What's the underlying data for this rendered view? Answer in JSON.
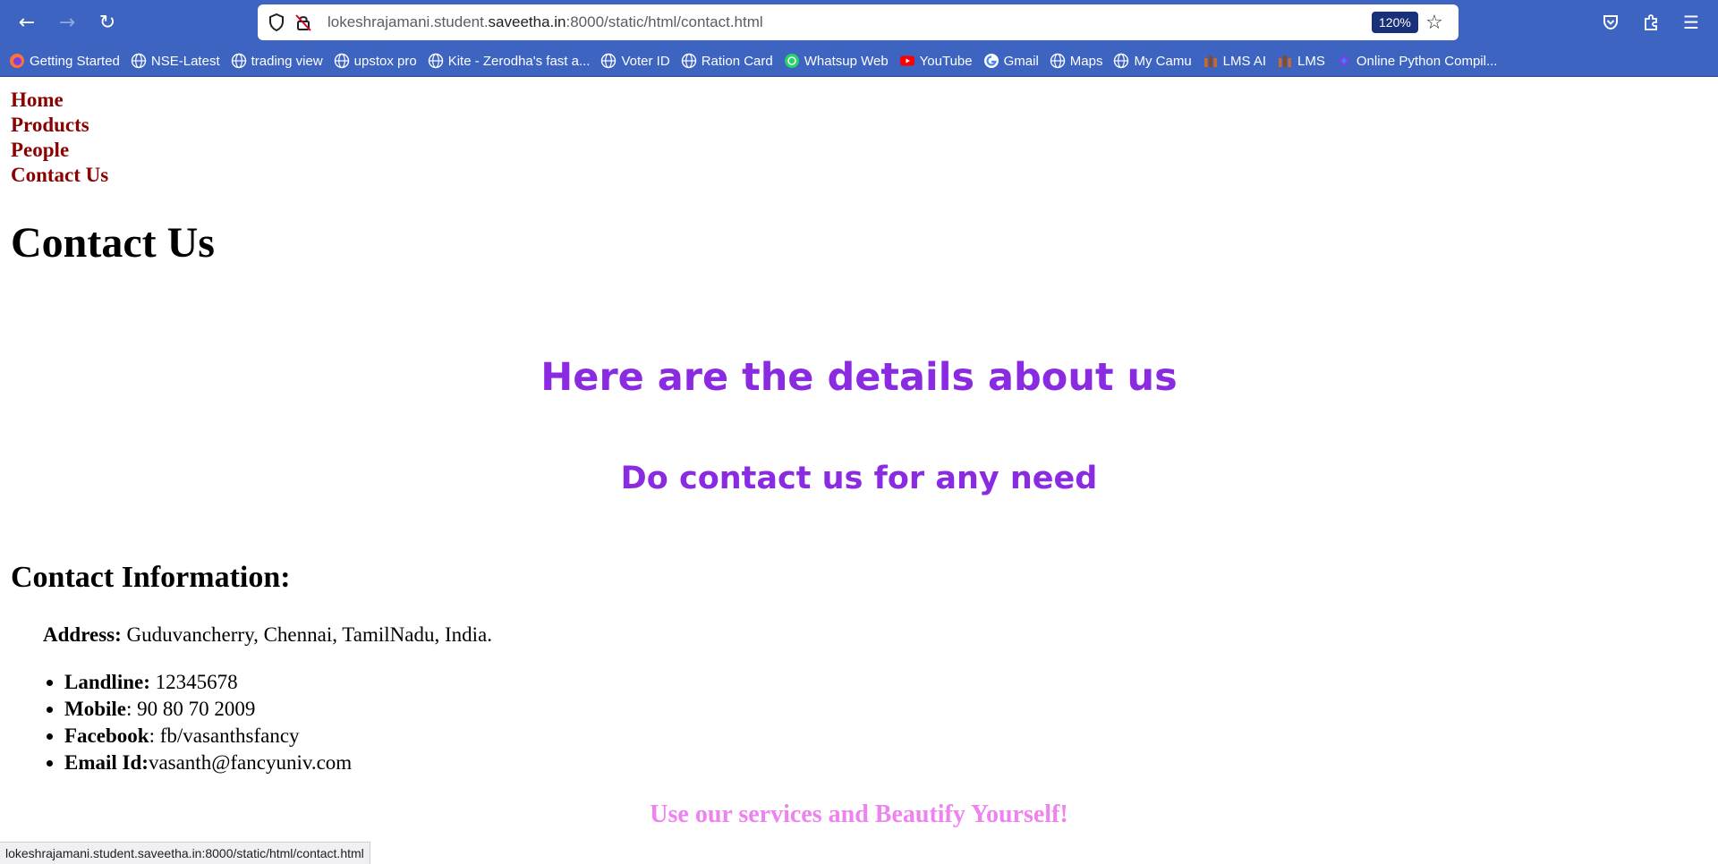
{
  "browser": {
    "url": {
      "prefix": "lokeshrajamani.student.",
      "domain": "saveetha.in",
      "suffix": ":8000/static/html/contact.html"
    },
    "zoom": "120%",
    "icons": {
      "back": "back-arrow-icon",
      "forward": "forward-arrow-icon",
      "reload": "reload-icon",
      "shield": "shield-icon",
      "insecure": "insecure-lock-icon",
      "star": "bookmark-star-icon",
      "pocket": "pocket-icon",
      "extensions": "extensions-puzzle-icon",
      "menu": "hamburger-menu-icon"
    },
    "bookmarks": [
      {
        "label": "Getting Started",
        "icon": "firefox-icon"
      },
      {
        "label": "NSE-Latest",
        "icon": "globe-icon"
      },
      {
        "label": "trading view",
        "icon": "globe-icon"
      },
      {
        "label": "upstox pro",
        "icon": "globe-icon"
      },
      {
        "label": "Kite - Zerodha's fast a...",
        "icon": "globe-icon"
      },
      {
        "label": "Voter ID",
        "icon": "globe-icon"
      },
      {
        "label": "Ration Card",
        "icon": "globe-icon"
      },
      {
        "label": "Whatsup Web",
        "icon": "whatsapp-icon"
      },
      {
        "label": "YouTube",
        "icon": "youtube-icon"
      },
      {
        "label": "Gmail",
        "icon": "google-icon"
      },
      {
        "label": "Maps",
        "icon": "globe-icon"
      },
      {
        "label": "My Camu",
        "icon": "globe-icon"
      },
      {
        "label": "LMS AI",
        "icon": "lms-icon"
      },
      {
        "label": "LMS",
        "icon": "lms-icon"
      },
      {
        "label": "Online Python Compil...",
        "icon": "python-compiler-icon"
      }
    ],
    "status_url": "lokeshrajamani.student.saveetha.in:8000/static/html/contact.html"
  },
  "site": {
    "nav": [
      "Home",
      "Products",
      "People",
      "Contact Us"
    ],
    "title": "Contact Us",
    "hero_heading": "Here are the details about us",
    "hero_sub": "Do contact us for any need",
    "info_heading": "Contact Information:",
    "address": {
      "label": "Address:",
      "value": " Guduvancherry, Chennai, TamilNadu, India."
    },
    "contacts": [
      {
        "label": "Landline:",
        "value": " 12345678"
      },
      {
        "label": "Mobile",
        "value": ": 90 80 70 2009"
      },
      {
        "label": "Facebook",
        "value": ": fb/vasanthsfancy"
      },
      {
        "label": "Email Id:",
        "value": "vasanth@fancyuniv.com"
      }
    ],
    "tagline": "Use our services and Beautify Yourself!",
    "colors": {
      "nav_link": "#8b0000",
      "hero": "#8a2be2",
      "tagline": "#ee82ee",
      "chrome": "#3d64c0"
    }
  }
}
